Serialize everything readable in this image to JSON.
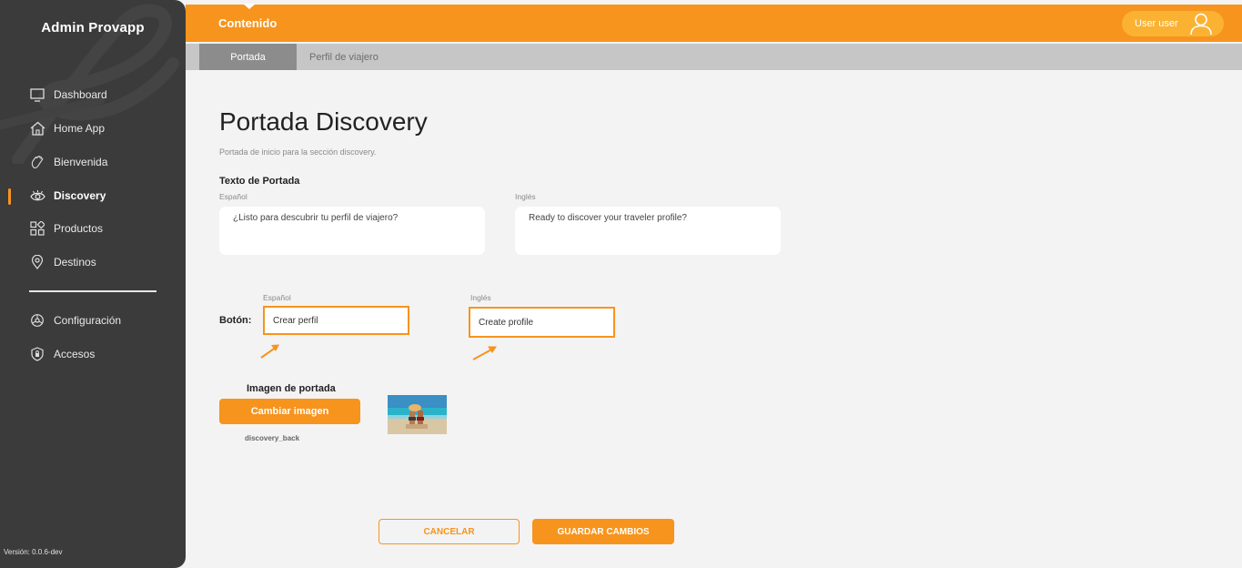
{
  "sidebar": {
    "brand": "Admin Provapp",
    "items": [
      {
        "label": "Dashboard",
        "icon": "monitor-icon"
      },
      {
        "label": "Home App",
        "icon": "home-icon"
      },
      {
        "label": "Bienvenida",
        "icon": "waving-hand-icon"
      },
      {
        "label": "Discovery",
        "icon": "eye-icon",
        "active": true
      },
      {
        "label": "Productos",
        "icon": "grid-icon"
      },
      {
        "label": "Destinos",
        "icon": "location-pin-icon"
      }
    ],
    "items_bottom": [
      {
        "label": "Configuración",
        "icon": "settings-icon"
      },
      {
        "label": "Accesos",
        "icon": "shield-icon"
      }
    ],
    "version": "Versión: 0.0.6-dev"
  },
  "topbar": {
    "title": "Contenido",
    "user_name": "User user"
  },
  "tabs": [
    {
      "label": "Portada",
      "active": true
    },
    {
      "label": "Perfil de viajero",
      "active": false
    }
  ],
  "main": {
    "title": "Portada Discovery",
    "subtitle": "Portada de inicio para la sección discovery.",
    "text_section_label": "Texto de Portada",
    "text_es_label": "Español",
    "text_en_label": "Inglés",
    "text_es_value": "¿Listo para descubrir tu perfil de viajero?",
    "text_en_value": "Ready to discover your traveler profile?",
    "button_label": "Botón:",
    "button_es_label": "Español",
    "button_en_label": "Inglés",
    "button_es_value": "Crear perfil",
    "button_en_value": "Create profile",
    "image_label": "Imagen de portada",
    "change_image_button": "Cambiar imagen",
    "image_file_name": "discovery_back",
    "cancel_button": "CANCELAR",
    "save_button": "GUARDAR CAMBIOS"
  },
  "colors": {
    "accent": "#f7941d",
    "sidebar_bg": "#3b3b3b",
    "page_bg": "#f3f3f4",
    "tab_bar": "#c6c6c6",
    "tab_active": "#8c8c8c"
  }
}
